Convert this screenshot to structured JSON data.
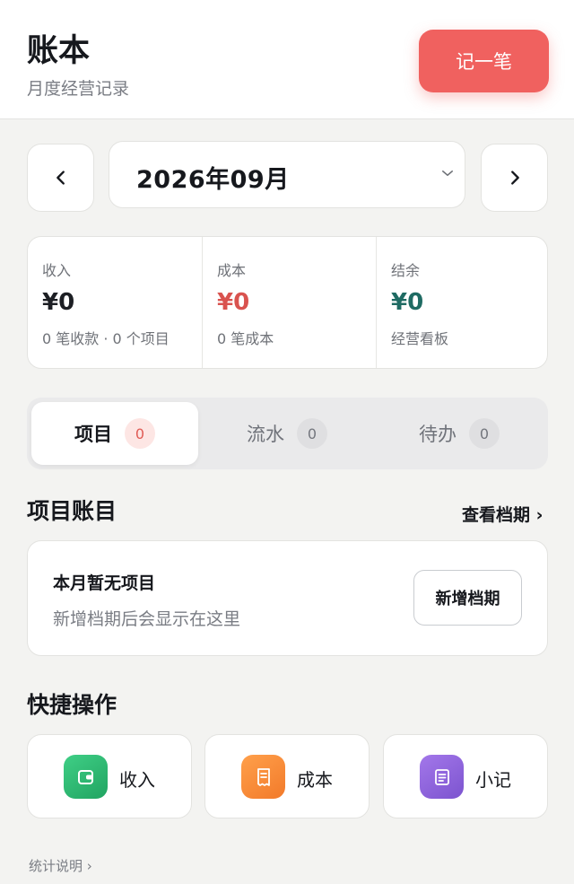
{
  "header": {
    "title": "账本",
    "subtitle": "月度经营记录",
    "record_button": "记一笔"
  },
  "month_picker": {
    "value": "2026年09月",
    "prev_icon": "chevron-left-icon",
    "next_icon": "chevron-right-icon",
    "dropdown_icon": "chevron-down-icon"
  },
  "summary": [
    {
      "label": "收入",
      "value": "¥0",
      "sub": "0 笔收款 · 0 个项目",
      "color": "#1d1f24"
    },
    {
      "label": "成本",
      "value": "¥0",
      "sub": "0 笔成本",
      "color": "#d9534f"
    },
    {
      "label": "结余",
      "value": "¥0",
      "sub": "经营看板",
      "color": "#1f6b63"
    }
  ],
  "tabs": [
    {
      "label": "项目",
      "count": "0",
      "active": true
    },
    {
      "label": "流水",
      "count": "0",
      "active": false
    },
    {
      "label": "待办",
      "count": "0",
      "active": false
    }
  ],
  "projects": {
    "title": "项目账目",
    "view_link": "查看档期 ›",
    "empty_title": "本月暂无项目",
    "empty_desc": "新增档期后会显示在这里",
    "new_button": "新增档期"
  },
  "quick_actions": {
    "title": "快捷操作",
    "items": [
      {
        "label": "收入",
        "icon": "wallet-icon",
        "color": "#2bb56e"
      },
      {
        "label": "成本",
        "icon": "receipt-icon",
        "color": "#f7893a"
      },
      {
        "label": "小记",
        "icon": "note-icon",
        "color": "#8a5fd8"
      }
    ]
  },
  "footer": {
    "stats_link": "统计说明 ›"
  }
}
